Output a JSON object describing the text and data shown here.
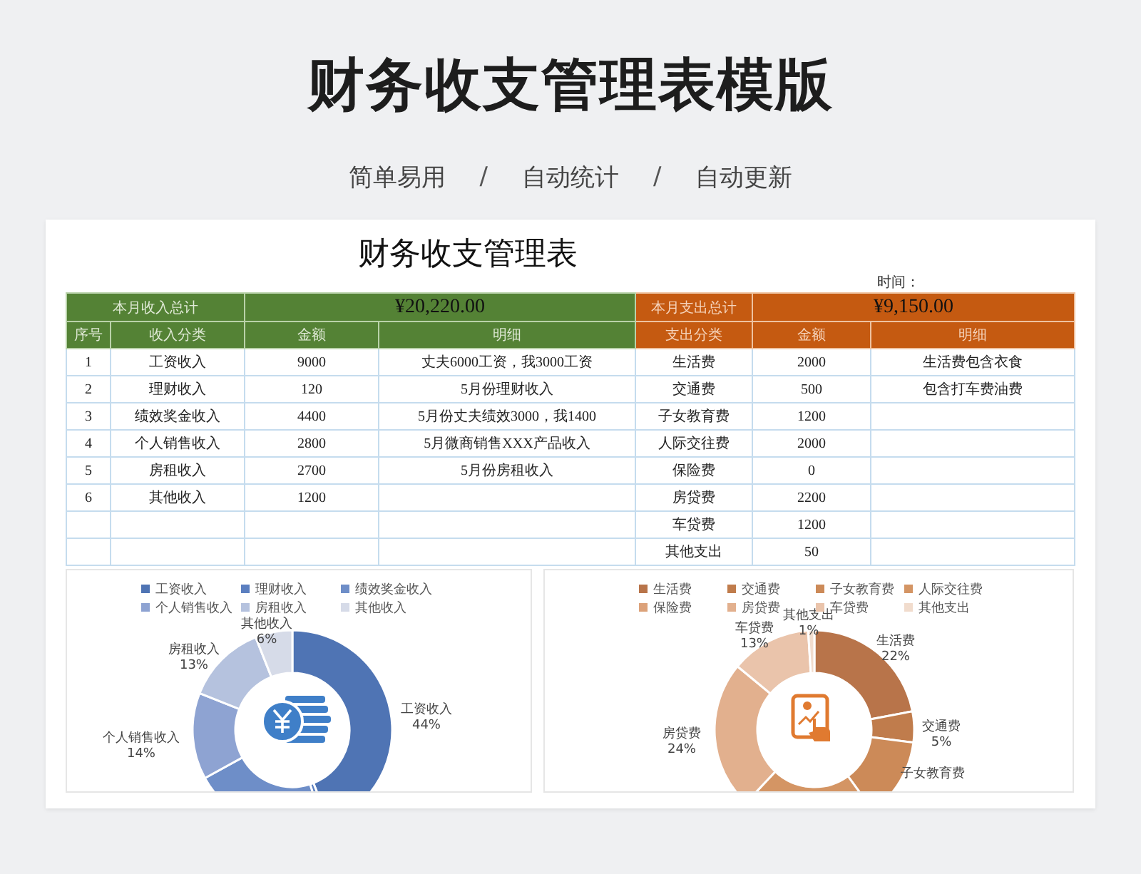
{
  "page_title": "财务收支管理表模版",
  "subtitle": [
    {
      "kind": "feature",
      "text": "简单易用"
    },
    {
      "kind": "separator",
      "text": "/"
    },
    {
      "kind": "feature",
      "text": "自动统计"
    },
    {
      "kind": "separator",
      "text": "/"
    },
    {
      "kind": "feature",
      "text": "自动更新"
    }
  ],
  "sheet": {
    "title": "财务收支管理表",
    "time_label": "时间：",
    "income": {
      "total_label": "本月收入总计",
      "total": "¥20,220.00",
      "columns": [
        "序号",
        "收入分类",
        "金额",
        "明细"
      ],
      "rows": [
        {
          "no": "1",
          "category": "工资收入",
          "amount": "9000",
          "detail": "丈夫6000工资，我3000工资"
        },
        {
          "no": "2",
          "category": "理财收入",
          "amount": "120",
          "detail": "5月份理财收入"
        },
        {
          "no": "3",
          "category": "绩效奖金收入",
          "amount": "4400",
          "detail": "5月份丈夫绩效3000，我1400"
        },
        {
          "no": "4",
          "category": "个人销售收入",
          "amount": "2800",
          "detail": "5月微商销售XXX产品收入"
        },
        {
          "no": "5",
          "category": "房租收入",
          "amount": "2700",
          "detail": "5月份房租收入"
        },
        {
          "no": "6",
          "category": "其他收入",
          "amount": "1200"
        }
      ]
    },
    "expense": {
      "total_label": "本月支出总计",
      "total": "¥9,150.00",
      "columns": [
        "支出分类",
        "金额",
        "明细"
      ],
      "rows": [
        {
          "category": "生活费",
          "amount": "2000",
          "detail": "生活费包含衣食"
        },
        {
          "category": "交通费",
          "amount": "500",
          "detail": "包含打车费油费"
        },
        {
          "category": "子女教育费",
          "amount": "1200"
        },
        {
          "category": "人际交往费",
          "amount": "2000"
        },
        {
          "category": "保险费",
          "amount": "0"
        },
        {
          "category": "房贷费",
          "amount": "2200"
        },
        {
          "category": "车贷费",
          "amount": "1200"
        },
        {
          "category": "其他支出",
          "amount": "50"
        }
      ]
    }
  },
  "charts": [
    {
      "chart_data": {
        "type": "donut",
        "legend": "top",
        "categories": [
          "工资收入",
          "理财收入",
          "绩效奖金收入",
          "个人销售收入",
          "房租收入",
          "其他收入"
        ],
        "values": [
          44,
          1,
          22,
          14,
          13,
          6
        ],
        "colors": [
          "#4f74b4",
          "#5b7fc0",
          "#6e8ec8",
          "#8ea3d2",
          "#b5c2de",
          "#d6dbe8"
        ],
        "value_labels": [
          "44%",
          null,
          null,
          "14%",
          "13%",
          "6%"
        ]
      }
    },
    {
      "chart_data": {
        "type": "donut",
        "legend": "top",
        "categories": [
          "生活费",
          "交通费",
          "子女教育费",
          "人际交往费",
          "保险费",
          "房贷费",
          "车贷费",
          "其他支出"
        ],
        "values": [
          22,
          5,
          13,
          22,
          0,
          24,
          13,
          1
        ],
        "colors": [
          "#b8744a",
          "#c07c4c",
          "#cc8a58",
          "#d49564",
          "#dca27a",
          "#e2b08e",
          "#eac4ab",
          "#f1dccd"
        ],
        "value_labels": [
          "22%",
          "5%",
          null,
          null,
          null,
          "24%",
          "13%",
          "1%"
        ]
      }
    }
  ]
}
